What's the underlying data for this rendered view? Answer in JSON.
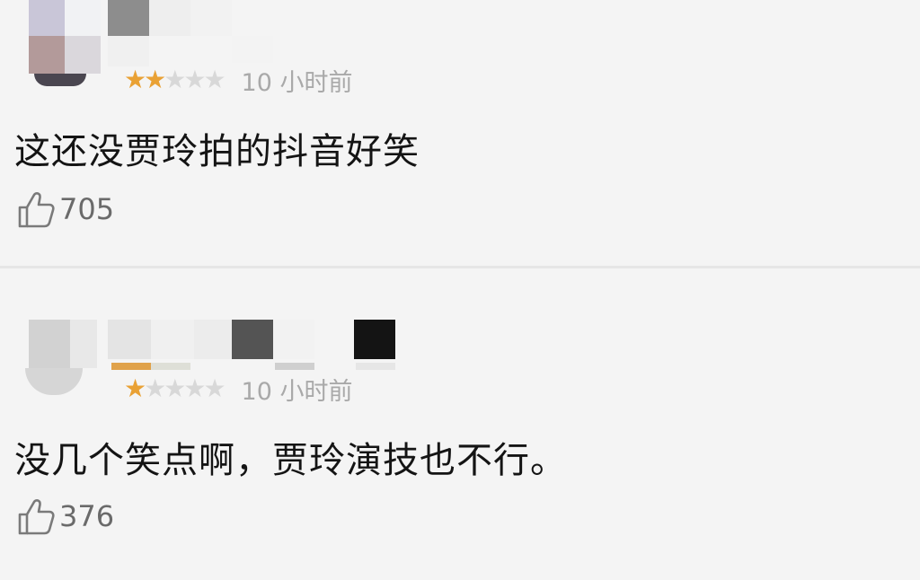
{
  "comments": [
    {
      "rating": {
        "filled": 2,
        "total": 5
      },
      "time": "10 小时前",
      "text": "这还没贾玲拍的抖音好笑",
      "likes": "705"
    },
    {
      "rating": {
        "filled": 1,
        "total": 5
      },
      "time": "10 小时前",
      "text": "没几个笑点啊，贾玲演技也不行。",
      "likes": "376"
    }
  ],
  "icons": {
    "rating_star": "star-icon",
    "like": "thumbs-up-icon"
  },
  "colors": {
    "star_filled": "#e9a134",
    "star_empty": "#d8d8d8",
    "time_text": "#a9a9a9",
    "like_count": "#6a6a6a",
    "background": "#f4f4f4"
  }
}
